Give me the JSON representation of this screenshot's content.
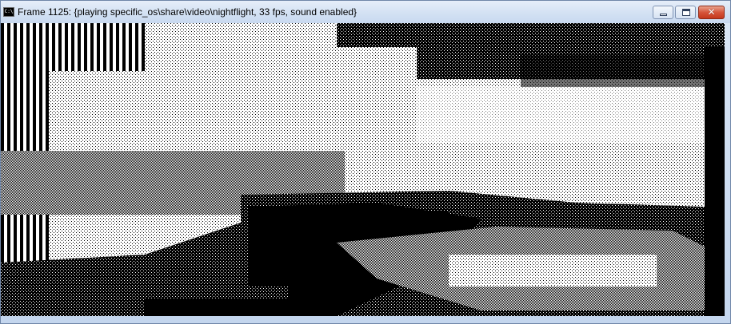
{
  "window": {
    "title": "Frame 1125: {playing specific_os\\share\\video\\nightflight, 33 fps, sound enabled}",
    "icon": "console-app-icon",
    "icon_text": "C:\\",
    "close_glyph": "✕"
  },
  "video": {
    "frame_number": 1125,
    "path": "specific_os\\share\\video\\nightflight",
    "fps": 33,
    "sound": "enabled",
    "palette": [
      "#000000",
      "#ffffff"
    ]
  }
}
